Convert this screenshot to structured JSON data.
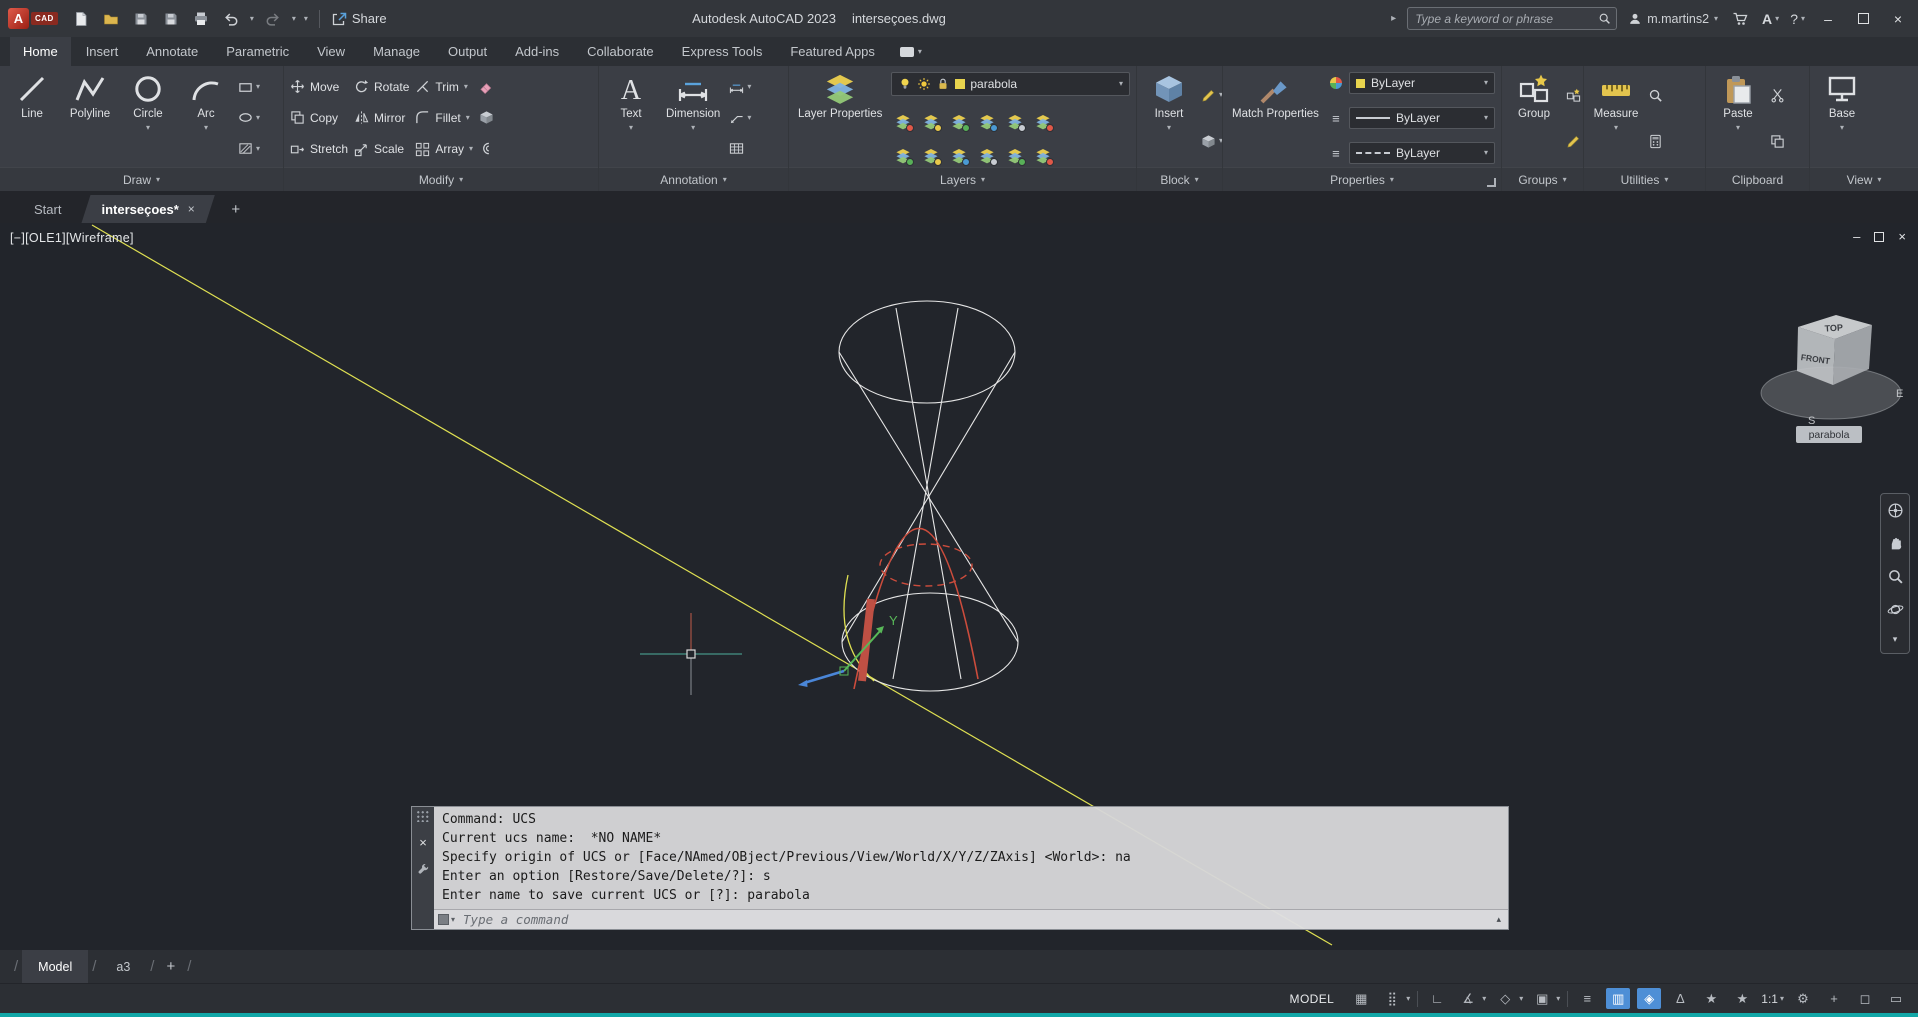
{
  "titlebar": {
    "app_name": "Autodesk AutoCAD 2023",
    "doc_name": "interseçoes.dwg",
    "share_label": "Share",
    "search_placeholder": "Type a keyword or phrase",
    "user_name": "m.martins2",
    "help_label": "?"
  },
  "ribbon_tabs": [
    "Home",
    "Insert",
    "Annotate",
    "Parametric",
    "View",
    "Manage",
    "Output",
    "Add-ins",
    "Collaborate",
    "Express Tools",
    "Featured Apps"
  ],
  "panels": {
    "draw": {
      "label": "Draw",
      "line": "Line",
      "polyline": "Polyline",
      "circle": "Circle",
      "arc": "Arc"
    },
    "modify": {
      "label": "Modify",
      "move": "Move",
      "rotate": "Rotate",
      "trim": "Trim",
      "copy": "Copy",
      "mirror": "Mirror",
      "fillet": "Fillet",
      "stretch": "Stretch",
      "scale": "Scale",
      "array": "Array"
    },
    "annotation": {
      "label": "Annotation",
      "text": "Text",
      "dimension": "Dimension"
    },
    "layers": {
      "label": "Layers",
      "layer_properties": "Layer Properties",
      "current_layer": "parabola"
    },
    "block": {
      "label": "Block",
      "insert": "Insert"
    },
    "properties": {
      "label": "Properties",
      "match_properties": "Match Properties",
      "color_value": "ByLayer",
      "lineweight_value": "ByLayer",
      "linetype_value": "ByLayer"
    },
    "groups": {
      "label": "Groups",
      "group": "Group"
    },
    "utilities": {
      "label": "Utilities",
      "measure": "Measure"
    },
    "clipboard": {
      "label": "Clipboard",
      "paste": "Paste"
    },
    "view": {
      "label": "View",
      "base": "Base"
    }
  },
  "file_tabs": {
    "start": "Start",
    "active_doc": "interseçoes*"
  },
  "viewport": {
    "view_label": "[−][OLE1][Wireframe]",
    "ucs_badge": "parabola",
    "axis_y": "Y",
    "viewcube": {
      "top": "TOP",
      "front": "FRONT",
      "south": "S",
      "east": "E"
    }
  },
  "command": {
    "lines": [
      "Command: UCS",
      "Current ucs name:  *NO NAME*",
      "Specify origin of UCS or [Face/NAmed/OBject/Previous/View/World/X/Y/Z/ZAxis] <World>: na",
      "Enter an option [Restore/Save/Delete/?]: s",
      "Enter name to save current UCS or [?]: parabola"
    ],
    "placeholder": "Type a command"
  },
  "layout_tabs": {
    "model": "Model",
    "a3": "a3",
    "new_layout": "+"
  },
  "statusbar": {
    "model_label": "MODEL",
    "scale": "1:1"
  },
  "icons": {
    "caret_down": "▾",
    "caret_up": "▴",
    "minimize": "–",
    "close": "×",
    "plus": "+",
    "expand": "▸",
    "grid": "▦",
    "snap": "⣿",
    "ortho": "∟",
    "polar": "∡",
    "isodraft": "◇",
    "osnap": "▣",
    "lineweight": "≡",
    "selection_cycling": "▥",
    "osnap_3d": "◈",
    "dynamic_ucs": "∆",
    "annotation_visibility": "★",
    "annotation_autoscale": "★",
    "settings_gear": "⚙",
    "isolate": "◻",
    "clean_screen": "▭"
  },
  "colors": {
    "accent_blue": "#4e8fd6",
    "layer_yellow": "#e8d44e",
    "wire_white": "#e6e6e6",
    "curve_red": "#cc4c3c",
    "line_yellow": "#dfe052"
  }
}
